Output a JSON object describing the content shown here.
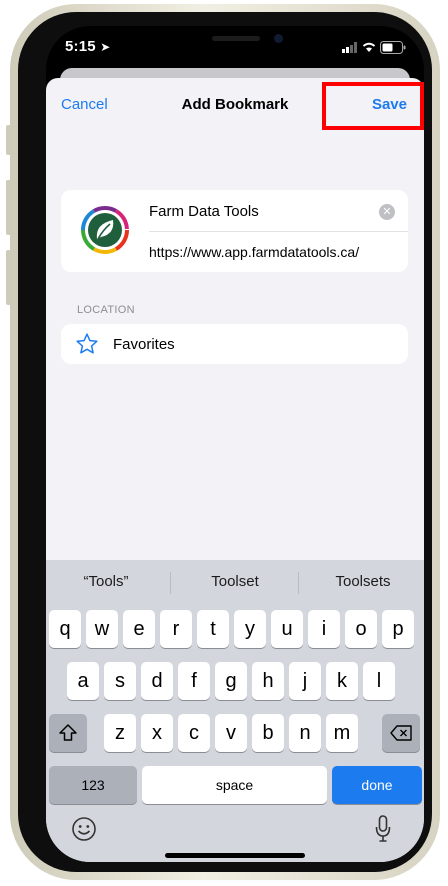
{
  "status_bar": {
    "time": "5:15"
  },
  "nav": {
    "cancel": "Cancel",
    "title": "Add Bookmark",
    "save": "Save"
  },
  "bookmark": {
    "title": "Farm Data Tools",
    "url": "https://www.app.farmdatatools.ca/"
  },
  "location": {
    "section_label": "LOCATION",
    "folder": "Favorites"
  },
  "keyboard": {
    "suggestions": [
      "“Tools”",
      "Toolset",
      "Toolsets"
    ],
    "row1": [
      "q",
      "w",
      "e",
      "r",
      "t",
      "y",
      "u",
      "i",
      "o",
      "p"
    ],
    "row2": [
      "a",
      "s",
      "d",
      "f",
      "g",
      "h",
      "j",
      "k",
      "l"
    ],
    "row3": [
      "z",
      "x",
      "c",
      "v",
      "b",
      "n",
      "m"
    ],
    "numbers_key": "123",
    "space_key": "space",
    "done_key": "done"
  },
  "colors": {
    "accent": "#1d7bf0",
    "highlight": "#ff0000",
    "background": "#f2f2f7"
  }
}
